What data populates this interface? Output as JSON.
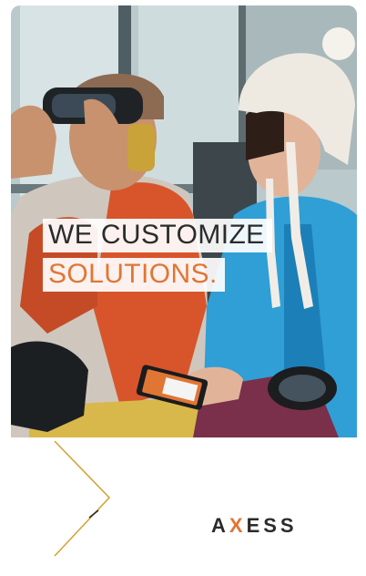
{
  "ad": {
    "headline_line1": "WE CUSTOMIZE",
    "headline_line2": "SOLUTIONS.",
    "brand_prefix": "A",
    "brand_x": "X",
    "brand_suffix": "ESS"
  },
  "colors": {
    "accent_orange": "#e07634",
    "headline_dark": "#2b2b2b",
    "jacket_blue": "#2f9fd6",
    "jacket_red": "#d8552b",
    "gold_line": "#d5a33a"
  },
  "icons": [
    "phone-icon"
  ]
}
